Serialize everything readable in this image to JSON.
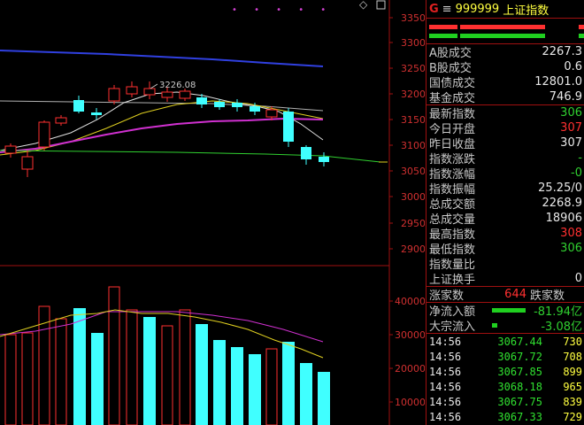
{
  "chart": {
    "price_axis": [
      "3350",
      "3300",
      "3250",
      "3200",
      "3150",
      "3100",
      "3050",
      "3000",
      "2950",
      "2900"
    ],
    "volume_axis": [
      "40000",
      "30000",
      "20000",
      "10000"
    ],
    "high_annotation": "3226.08",
    "top_markers": "• • • • •",
    "diamond": "◇",
    "colors": {
      "up": "#ff3030",
      "down": "#40ffff",
      "grid": "#a01010"
    }
  },
  "panel": {
    "header": {
      "g": "G",
      "menu": "≡",
      "code": "999999",
      "name": "上证指数"
    },
    "rows": [
      {
        "label": "A股成交",
        "value": "2267.3",
        "color": "white"
      },
      {
        "label": "B股成交",
        "value": "0.6",
        "color": "white"
      },
      {
        "label": "国债成交",
        "value": "12801.0",
        "color": "white"
      },
      {
        "label": "基金成交",
        "value": "746.9",
        "color": "white"
      }
    ],
    "rows2": [
      {
        "label": "最新指数",
        "value": "306",
        "color": "green"
      },
      {
        "label": "今日开盘",
        "value": "307",
        "color": "red"
      },
      {
        "label": "昨日收盘",
        "value": "307",
        "color": "white"
      },
      {
        "label": "指数涨跌",
        "value": "-",
        "color": "green"
      },
      {
        "label": "指数涨幅",
        "value": "-0",
        "color": "green"
      },
      {
        "label": "指数振幅",
        "value": "25.25/0",
        "color": "white"
      },
      {
        "label": "总成交额",
        "value": "2268.9",
        "color": "white"
      },
      {
        "label": "总成交量",
        "value": "18906",
        "color": "white"
      },
      {
        "label": "最高指数",
        "value": "308",
        "color": "red"
      },
      {
        "label": "最低指数",
        "value": "306",
        "color": "green"
      },
      {
        "label": "指数量比",
        "value": "",
        "color": "white"
      },
      {
        "label": "上证换手",
        "value": "0",
        "color": "white"
      }
    ],
    "breadth": {
      "up_label": "涨家数",
      "up_value": "644",
      "down_label": "跌家数"
    },
    "flows": [
      {
        "label": "净流入额",
        "value": "-81.94亿"
      },
      {
        "label": "大宗流入",
        "value": "-3.08亿"
      }
    ],
    "ticks": [
      {
        "time": "14:56",
        "price": "3067.44",
        "vol": "730"
      },
      {
        "time": "14:56",
        "price": "3067.72",
        "vol": "708"
      },
      {
        "time": "14:56",
        "price": "3067.85",
        "vol": "899"
      },
      {
        "time": "14:56",
        "price": "3068.18",
        "vol": "965"
      },
      {
        "time": "14:56",
        "price": "3067.75",
        "vol": "839"
      },
      {
        "time": "14:56",
        "price": "3067.33",
        "vol": "729"
      }
    ]
  }
}
